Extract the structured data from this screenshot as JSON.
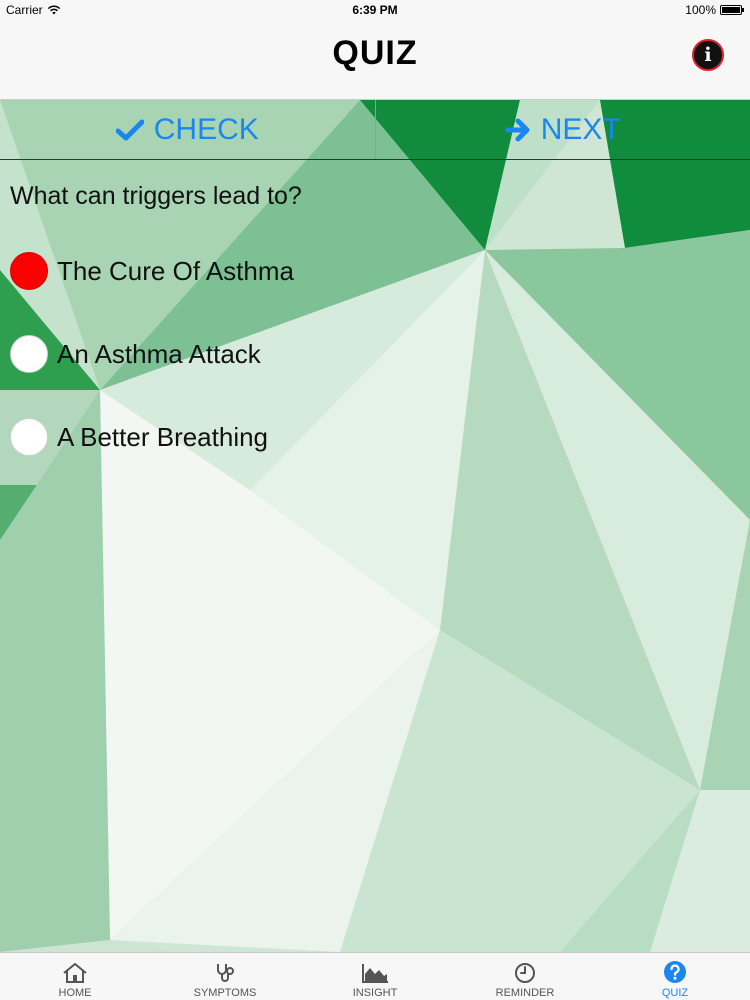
{
  "status_bar": {
    "carrier": "Carrier",
    "time": "6:39 PM",
    "battery": "100%"
  },
  "nav": {
    "title": "QUIZ",
    "info_icon": "info-icon",
    "info_glyph": "i"
  },
  "actions": {
    "check_label": "CHECK",
    "check_icon": "checkmark-icon",
    "next_label": "NEXT",
    "next_icon": "arrow-right-icon",
    "color": "#1a86f0"
  },
  "quiz": {
    "question": "What can triggers lead to?",
    "options": [
      {
        "label": "The Cure Of Asthma",
        "selected": true
      },
      {
        "label": "An Asthma Attack",
        "selected": false
      },
      {
        "label": "A Better Breathing",
        "selected": false
      }
    ],
    "selected_color": "#fa0000"
  },
  "tabs": [
    {
      "label": "HOME",
      "icon": "home-icon",
      "active": false
    },
    {
      "label": "SYMPTOMS",
      "icon": "stethoscope-icon",
      "active": false
    },
    {
      "label": "INSIGHT",
      "icon": "area-chart-icon",
      "active": false
    },
    {
      "label": "REMINDER",
      "icon": "clock-icon",
      "active": false
    },
    {
      "label": "QUIZ",
      "icon": "question-circle-icon",
      "active": true
    }
  ],
  "theme": {
    "accent": "#1a86f0",
    "background_green": "#2e9e4f"
  }
}
